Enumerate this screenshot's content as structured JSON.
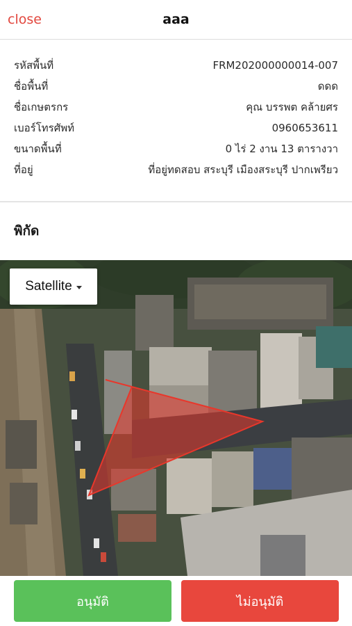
{
  "header": {
    "close_label": "close",
    "title": "aaa"
  },
  "info": {
    "rows": [
      {
        "label": "รหัสพื้นที่",
        "value": "FRM202000000014-007"
      },
      {
        "label": "ชื่อพื้นที่",
        "value": "ดดด"
      },
      {
        "label": "ชื่อเกษตรกร",
        "value": "คุณ บรรพต คล้ายศร"
      },
      {
        "label": "เบอร์โทรศัพท์",
        "value": "0960653611"
      },
      {
        "label": "ขนาดพื้นที่",
        "value": "0 ไร่ 2 งาน 13 ตารางวา"
      },
      {
        "label": "ที่อยู่",
        "value": "ที่อยู่ทดสอบ สระบุรี เมืองสระบุรี ปากเพรียว"
      }
    ]
  },
  "location": {
    "title": "พิกัด"
  },
  "map": {
    "type_selector_label": "Satellite",
    "polygon_color": "#e8372b"
  },
  "actions": {
    "approve_label": "อนุมัติ",
    "reject_label": "ไม่อนุมัติ",
    "approve_color": "#5ac15a",
    "reject_color": "#e8473d"
  }
}
